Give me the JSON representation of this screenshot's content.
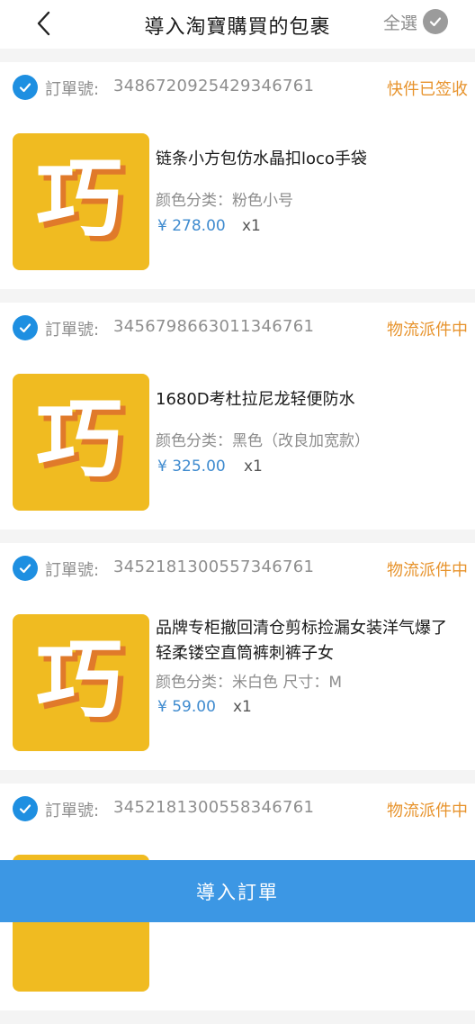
{
  "header": {
    "title": "導入淘寶購買的包裹",
    "select_all_label": "全選"
  },
  "order_label": "訂單號:",
  "orders": [
    {
      "order_no": "3486720925429346761",
      "status": "快件已签收",
      "item_title": "链条小方包仿水晶扣loco手袋",
      "spec": "颜色分类：粉色小号",
      "price": "¥ 278.00",
      "qty": "x1"
    },
    {
      "order_no": "3456798663011346761",
      "status": "物流派件中",
      "item_title": "1680D考杜拉尼龙轻便防水",
      "spec": "颜色分类：黑色（改良加宽款）",
      "price": "¥ 325.00",
      "qty": "x1"
    },
    {
      "order_no": "3452181300557346761",
      "status": "物流派件中",
      "item_title": "品牌专柜撤回清仓剪标捡漏女装洋气爆了  轻柔镂空直筒裤刺裤子女",
      "spec": "颜色分类：米白色    尺寸：M",
      "price": "¥ 59.00",
      "qty": "x1"
    },
    {
      "order_no": "3452181300558346761",
      "status": "物流派件中"
    }
  ],
  "bottom": {
    "import_label": "導入訂單"
  },
  "thumb_glyph": "巧",
  "colors": {
    "accent": "#1e8fe1",
    "status": "#e7932c",
    "price": "#3f8bcf",
    "thumb_bg": "#f0bb21"
  }
}
